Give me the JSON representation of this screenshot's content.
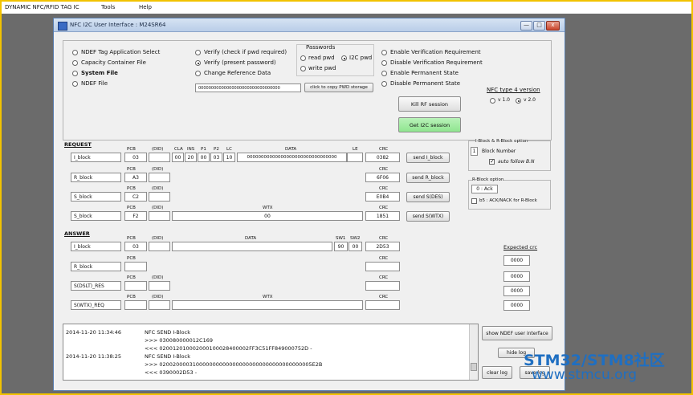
{
  "menubar": {
    "app_title": "DYNAMIC NFC/RFID TAG IC",
    "tools": "Tools",
    "help": "Help"
  },
  "window": {
    "title": "NFC I2C User Interface : M24SR64",
    "minimize": "—",
    "restore": "□",
    "close": "x"
  },
  "file_select": [
    "NDEF Tag Application Select",
    "Capacity Container File",
    "System File",
    "NDEF File"
  ],
  "verify": [
    "Verify (check if pwd required)",
    "Verify (present password)",
    "Change Reference Data"
  ],
  "password_field": "00000000000000000000000000000000",
  "copy_pwd_button": "click to copy PWD storage",
  "passwords": {
    "title": "Passwords",
    "read": "read pwd",
    "i2c": "I2C pwd",
    "write": "write pwd"
  },
  "permissions": [
    "Enable Verification Requirement",
    "Disable Verification Requirement",
    "Enable Permanent State",
    "Disable Permanent State"
  ],
  "nfc_type": {
    "title": "NFC type 4 version",
    "v1": "v 1.0",
    "v2": "v 2.0"
  },
  "kill_rf_button": "Kill RF session",
  "get_i2c_button": "Get I2C session",
  "request": {
    "title": "REQUEST",
    "i_block": {
      "name": "I_block",
      "pcb": "03",
      "did": "",
      "cla": "00",
      "ins": "20",
      "p1": "00",
      "p2": "03",
      "lc": "10",
      "data": "00000000000000000000000000000000",
      "le": "",
      "crc": "0382",
      "button": "send I_block"
    },
    "r_block": {
      "name": "R_block",
      "pcb": "A3",
      "did": "",
      "crc": "6F06",
      "button": "send R_block"
    },
    "s_block": {
      "name": "S_block",
      "pcb": "C2",
      "did": "",
      "crc": "E0B4",
      "button": "send S(DES)"
    },
    "s_wtx": {
      "name": "S_block",
      "pcb": "F2",
      "did": "",
      "wtx": "00",
      "crc": "1851",
      "button": "send S(WTX)"
    }
  },
  "headers": {
    "pcb": "PCB",
    "did": "(DID)",
    "cla": "CLA",
    "ins": "INS",
    "p1": "P1",
    "p2": "P2",
    "lc": "LC",
    "data": "DATA",
    "le": "LE",
    "crc": "CRC",
    "wtx": "WTX",
    "sw1": "SW1",
    "sw2": "SW2"
  },
  "answer": {
    "title": "ANSWER",
    "i_block": {
      "name": "I_block",
      "pcb": "03",
      "did": "",
      "data": "",
      "sw1": "90",
      "sw2": "00",
      "crc": "2D53"
    },
    "r_block": {
      "name": "R_block",
      "pcb": "",
      "did": "",
      "crc": ""
    },
    "s_dslt": {
      "name": "S(DSLT)_RES",
      "pcb": "",
      "did": "",
      "crc": ""
    },
    "s_wtx": {
      "name": "S(WTX)_REQ",
      "pcb": "",
      "did": "",
      "wtx": "",
      "crc": ""
    }
  },
  "iblock_option": {
    "title": "I-Block & R-Block option",
    "block_number_value": "1",
    "block_number_label": "Block Number",
    "auto_follow": "auto follow B.N"
  },
  "rblock_option": {
    "title": "R-Block option",
    "ack_value": "0 : Ack",
    "b5_label": "b5 : ACK/NACK for R-Block"
  },
  "expected_crc": {
    "title": "Expected crc",
    "values": [
      "0000",
      "0000",
      "0000",
      "0000"
    ]
  },
  "log": [
    {
      "time": "2014-11-20 11:34:46",
      "lines": [
        "NFC SEND I-Block",
        ">>> 030080000012C169",
        "<<< 020012010002000100028400002FF3C51FF849000752D -"
      ]
    },
    {
      "time": "2014-11-20 11:38:25",
      "lines": [
        "NFC SEND I-Block",
        ">>> 0200200003100000000000000000000000000000000005E2B",
        "<<< 0390002D53 -"
      ]
    }
  ],
  "log_buttons": {
    "show_ndef": "show NDEF user interface",
    "hide_log": "hide log",
    "clear_log": "clear log",
    "save_log": "save log"
  },
  "watermark": {
    "line1": "STM32/STM8社区",
    "line2": "www.stmcu.org"
  }
}
